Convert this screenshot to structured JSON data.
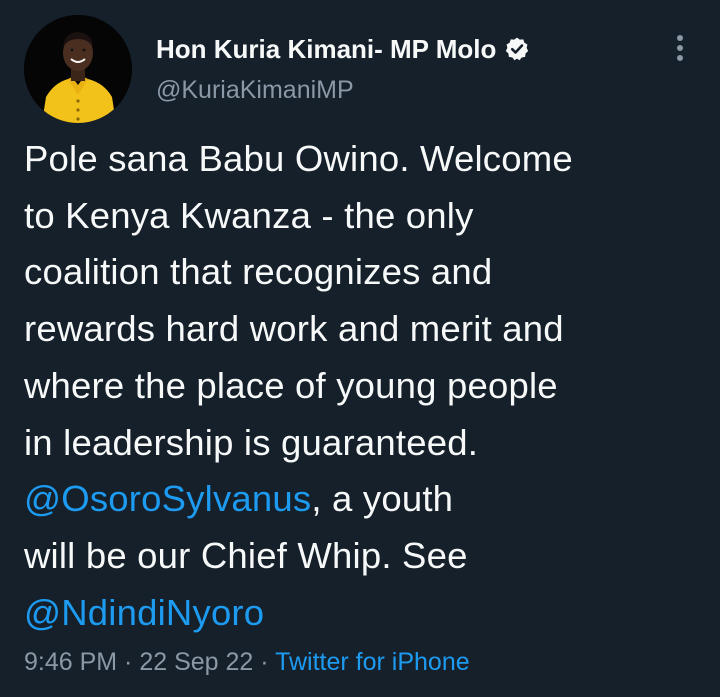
{
  "author": {
    "display_name": "Hon Kuria Kimani- MP Molo",
    "handle": "@KuriaKimaniMP",
    "verified": true
  },
  "colors": {
    "background": "#15202b",
    "text": "#f7f9f9",
    "secondary": "#8b98a5",
    "link": "#1d9bf0",
    "avatar_jacket": "#f2c21b"
  },
  "tweet": {
    "lines": [
      {
        "text": "Pole sana Babu Owino. Welcome"
      },
      {
        "text": "to Kenya Kwanza - the only"
      },
      {
        "text": "coalition that recognizes and"
      },
      {
        "text": "rewards hard work and merit and"
      },
      {
        "text": "where the place of young people"
      },
      {
        "text": "in leadership is guaranteed."
      },
      {
        "mention": "@OsoroSylvanus",
        "text": ", a youth"
      },
      {
        "text": "will be our Chief Whip. See"
      },
      {
        "mention": "@NdindiNyoro"
      }
    ]
  },
  "meta": {
    "time": "9:46 PM",
    "separator": " · ",
    "date": "22 Sep 22",
    "source": "Twitter for iPhone"
  },
  "icons": {
    "verified": "verified-badge-icon",
    "more": "more-vertical-icon"
  }
}
